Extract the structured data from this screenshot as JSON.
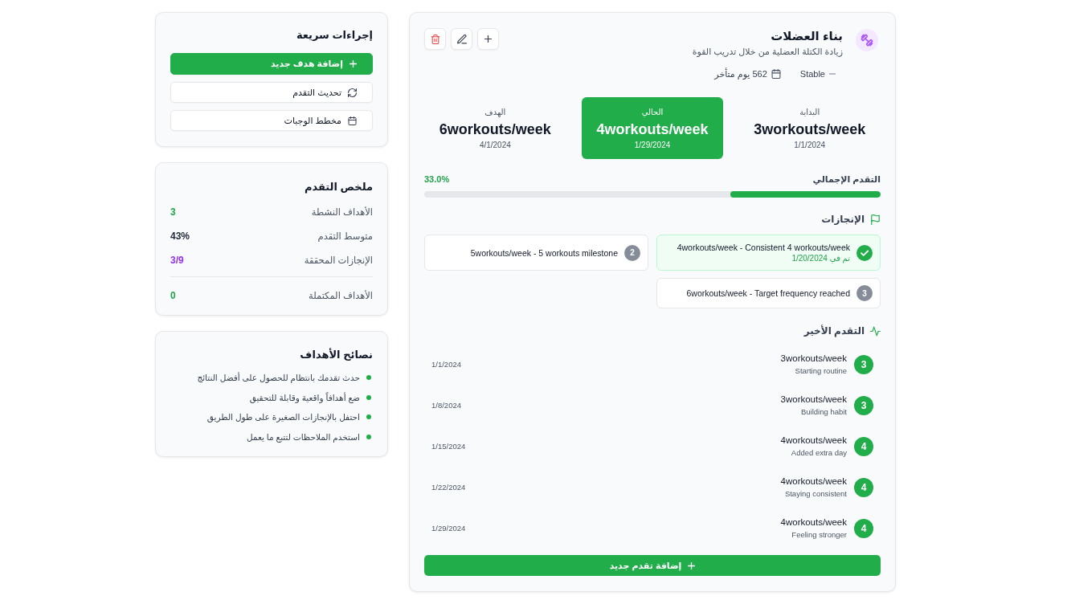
{
  "goal": {
    "title": "بناء العضلات",
    "description": "زيادة الكتلة العضلية من خلال تدريب القوة",
    "trend": "Stable",
    "days_status": "562 يوم متأخر",
    "stats": [
      {
        "label": "البداية",
        "value": "3workouts/week",
        "date": "1/1/2024",
        "highlighted": false
      },
      {
        "label": "الحالي",
        "value": "4workouts/week",
        "date": "1/29/2024",
        "highlighted": true
      },
      {
        "label": "الهدف",
        "value": "6workouts/week",
        "date": "4/1/2024",
        "highlighted": false
      }
    ],
    "overall_progress": {
      "label": "التقدم الإجمالي",
      "reading": "33.0%",
      "level": 0.33
    },
    "achievements": {
      "title": "الإنجازات",
      "items": [
        {
          "text": "4workouts/week - Consistent 4 workouts/week",
          "completed": true,
          "date": "تم في 1/20/2024"
        },
        {
          "text": "5workouts/week - 5 workouts milestone",
          "completed": false,
          "number": "2"
        },
        {
          "text": "6workouts/week - Target frequency reached",
          "completed": false,
          "number": "3"
        }
      ]
    },
    "recent_progress": {
      "title": "التقدم الأخير",
      "entries": [
        {
          "badge": "3",
          "value": "3workouts/week",
          "note": "Starting routine",
          "date": "1/1/2024"
        },
        {
          "badge": "3",
          "value": "3workouts/week",
          "note": "Building habit",
          "date": "1/8/2024"
        },
        {
          "badge": "4",
          "value": "4workouts/week",
          "note": "Added extra day",
          "date": "1/15/2024"
        },
        {
          "badge": "4",
          "value": "4workouts/week",
          "note": "Staying consistent",
          "date": "1/22/2024"
        },
        {
          "badge": "4",
          "value": "4workouts/week",
          "note": "Feeling stronger",
          "date": "1/29/2024"
        }
      ]
    },
    "add_progress_button": "إضافة تقدم جديد"
  },
  "quick_actions": {
    "title": "إجراءات سريعة",
    "buttons": [
      {
        "label": "إضافة هدف جديد",
        "kind": "add"
      },
      {
        "label": "تحديث التقدم",
        "kind": "refresh"
      },
      {
        "label": "مخطط الوجبات",
        "kind": "schedule"
      }
    ]
  },
  "summary": {
    "title": "ملخص التقدم",
    "sections": [
      {
        "rows": [
          {
            "label": "الأهداف النشطة",
            "value": "3",
            "color": "#22a34a"
          },
          {
            "label": "متوسط التقدم",
            "value": "43%",
            "color": "#1f2937"
          },
          {
            "label": "الإنجازات المحققة",
            "value": "3/9",
            "color": "#9333ea"
          }
        ]
      },
      {
        "rows": [
          {
            "label": "الأهداف المكتملة",
            "value": "0",
            "color": "#22a34a"
          }
        ]
      }
    ]
  },
  "tips": {
    "title": "نصائح الأهداف",
    "items": [
      "حدث تقدمك بانتظام للحصول على أفضل النتائج",
      "ضع أهدافاً واقعية وقابلة للتحقيق",
      "احتفل بالإنجازات الصغيرة على طول الطريق",
      "استخدم الملاحظات لتتبع ما يعمل"
    ]
  }
}
